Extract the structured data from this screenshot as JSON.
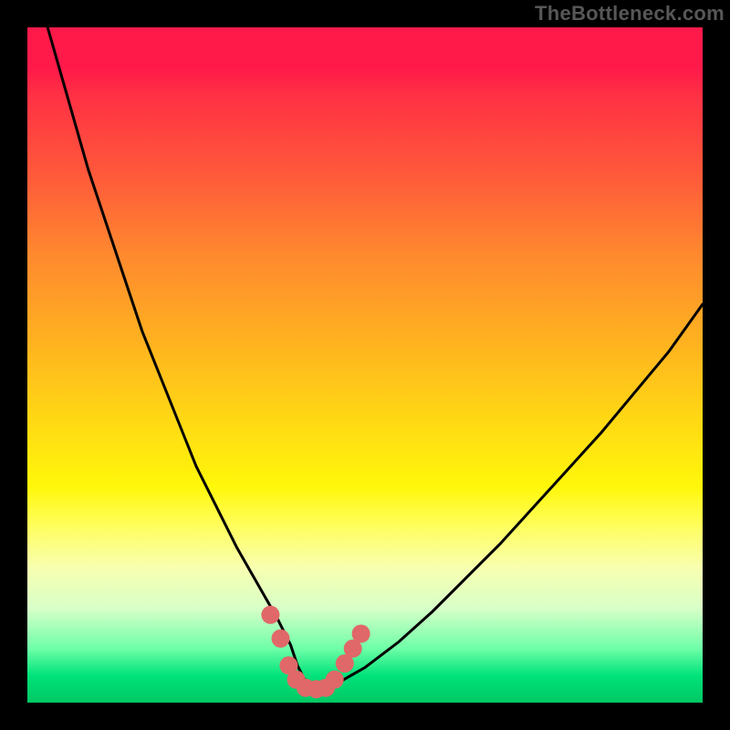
{
  "watermark": "TheBottleneck.com",
  "chart_data": {
    "type": "line",
    "title": "",
    "xlabel": "",
    "ylabel": "",
    "xlim": [
      0,
      100
    ],
    "ylim": [
      0,
      100
    ],
    "series": [
      {
        "name": "bottleneck-curve",
        "x": [
          3,
          5,
          7,
          9,
          11,
          13,
          15,
          17,
          19,
          21,
          23,
          25,
          27,
          29,
          31,
          33,
          35,
          37,
          38,
          39,
          40,
          41,
          43,
          45,
          47,
          50,
          55,
          60,
          65,
          70,
          75,
          80,
          85,
          90,
          95,
          100
        ],
        "y": [
          100,
          93,
          86,
          79,
          73,
          67,
          61,
          55,
          50,
          45,
          40,
          35,
          31,
          27,
          23,
          19.5,
          16,
          12.5,
          10.5,
          8.5,
          5.5,
          3.5,
          2.2,
          2.2,
          3.5,
          5.2,
          9,
          13.5,
          18.5,
          23.5,
          29,
          34.5,
          40,
          46,
          52,
          59
        ]
      }
    ],
    "markers": [
      {
        "name": "dot-left-1",
        "x": 36.0,
        "y": 13.0
      },
      {
        "name": "dot-left-2",
        "x": 37.5,
        "y": 9.5
      },
      {
        "name": "dot-body-1",
        "x": 38.7,
        "y": 5.5
      },
      {
        "name": "dot-body-2",
        "x": 39.8,
        "y": 3.4
      },
      {
        "name": "dot-body-3",
        "x": 41.2,
        "y": 2.2
      },
      {
        "name": "dot-body-4",
        "x": 42.8,
        "y": 2.0
      },
      {
        "name": "dot-body-5",
        "x": 44.2,
        "y": 2.2
      },
      {
        "name": "dot-body-6",
        "x": 45.5,
        "y": 3.4
      },
      {
        "name": "dot-right-1",
        "x": 47.0,
        "y": 5.8
      },
      {
        "name": "dot-right-2",
        "x": 48.2,
        "y": 8.0
      },
      {
        "name": "dot-right-3",
        "x": 49.4,
        "y": 10.2
      }
    ],
    "marker_radius_px": 10,
    "marker_color": "#e06868",
    "curve_color": "#000000"
  }
}
